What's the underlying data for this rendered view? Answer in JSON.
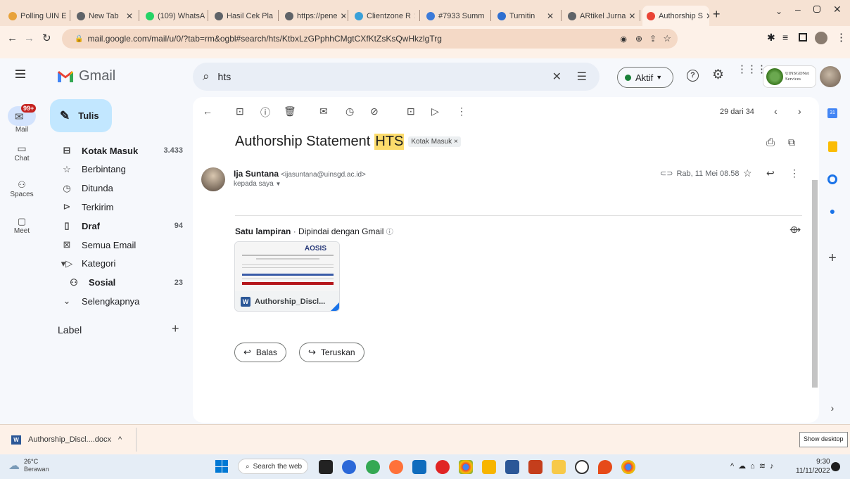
{
  "browser": {
    "tabs": [
      {
        "label": "Polling UIN E",
        "fav": "#e8a23a"
      },
      {
        "label": "New Tab",
        "fav": "#5f6368"
      },
      {
        "label": "(109) WhatsA",
        "fav": "#25d366"
      },
      {
        "label": "Hasil Cek Pla",
        "fav": "#5f6368"
      },
      {
        "label": "https://pene",
        "fav": "#5f6368"
      },
      {
        "label": "Clientzone R",
        "fav": "#3aa0d8"
      },
      {
        "label": "#7933 Summ",
        "fav": "#3c7bd9"
      },
      {
        "label": "Turnitin",
        "fav": "#2f6fd0"
      },
      {
        "label": "ARtikel Jurna",
        "fav": "#5f6368"
      },
      {
        "label": "Authorship S",
        "fav": "#ea4335"
      }
    ],
    "url": "mail.google.com/mail/u/0/?tab=rm&ogbl#search/hts/KtbxLzGPphhCMgtCXfKtZsKsQwHkzlgTrg"
  },
  "gmail": {
    "logo_text": "Gmail",
    "rail": [
      {
        "label": "Mail",
        "badge": "99+"
      },
      {
        "label": "Chat"
      },
      {
        "label": "Spaces"
      },
      {
        "label": "Meet"
      }
    ],
    "compose_label": "Tulis",
    "nav": [
      {
        "label": "Kotak Masuk",
        "count": "3.433",
        "icon": "inbox-icon"
      },
      {
        "label": "Berbintang",
        "count": "",
        "icon": "star-icon"
      },
      {
        "label": "Ditunda",
        "count": "",
        "icon": "clock-icon"
      },
      {
        "label": "Terkirim",
        "count": "",
        "icon": "send-icon"
      },
      {
        "label": "Draf",
        "count": "94",
        "icon": "draft-icon"
      },
      {
        "label": "Semua Email",
        "count": "",
        "icon": "all-mail-icon"
      },
      {
        "label": "Kategori",
        "count": "",
        "icon": "label-icon"
      },
      {
        "label": "Sosial",
        "count": "23",
        "icon": "people-icon"
      },
      {
        "label": "Selengkapnya",
        "count": "",
        "icon": "chevron-down-icon"
      }
    ],
    "labels_heading": "Label",
    "search_value": "hts",
    "status_label": "Aktif",
    "org_label": "UINSGDNet Services",
    "pagination": "29 dari 34",
    "email": {
      "subject_prefix": "Authorship Statement",
      "subject_highlight": "HTS",
      "tag": "Kotak Masuk",
      "sender_name": "Ija Suntana",
      "sender_email": "<ijasuntana@uinsgd.ac.id>",
      "recipient": "kepada saya",
      "date": "Rab, 11 Mei 08.58",
      "attachments_title": "Satu lampiran",
      "scan_note": "Dipindai dengan Gmail",
      "attachment_name": "Authorship_Discl...",
      "attachment_thumb_brand": "AOSIS",
      "reply_label": "Balas",
      "forward_label": "Teruskan"
    }
  },
  "download_bar": {
    "filename": "Authorship_Discl....docx",
    "show_desktop": "Show desktop"
  },
  "taskbar": {
    "weather_temp": "26°C",
    "weather_desc": "Berawan",
    "search_placeholder": "Search the web",
    "time": "9:30",
    "date": "11/11/2022"
  }
}
